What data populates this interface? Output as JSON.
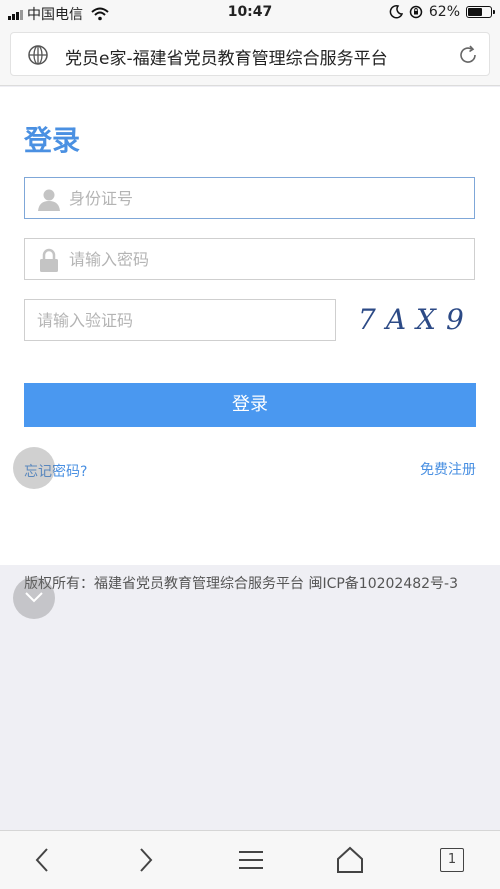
{
  "status_bar": {
    "carrier": "中国电信",
    "time": "10:47",
    "battery_percent": "62%",
    "battery_level": 0.62
  },
  "address_bar": {
    "page_title": "党员e家-福建省党员教育管理综合服务平台"
  },
  "login": {
    "heading": "登录",
    "id_placeholder": "身份证号",
    "password_placeholder": "请输入密码",
    "captcha_placeholder": "请输入验证码",
    "captcha_text": "7AX9",
    "submit_label": "登录",
    "forgot_label": "忘记密码?",
    "register_label": "免费注册"
  },
  "footer": {
    "copyright": "版权所有：福建省党员教育管理综合服务平台 闽ICP备10202482号-3"
  },
  "toolbar": {
    "tab_count": "1"
  },
  "colors": {
    "accent": "#4a90e2",
    "button": "#4a98f0"
  },
  "icons": [
    "signal-icon",
    "wifi-icon",
    "moon-icon",
    "orientation-lock-icon",
    "battery-icon",
    "globe-icon",
    "reload-icon",
    "user-icon",
    "lock-icon",
    "chevron-down-icon",
    "back-icon",
    "forward-icon",
    "menu-icon",
    "home-icon",
    "tabs-icon"
  ]
}
